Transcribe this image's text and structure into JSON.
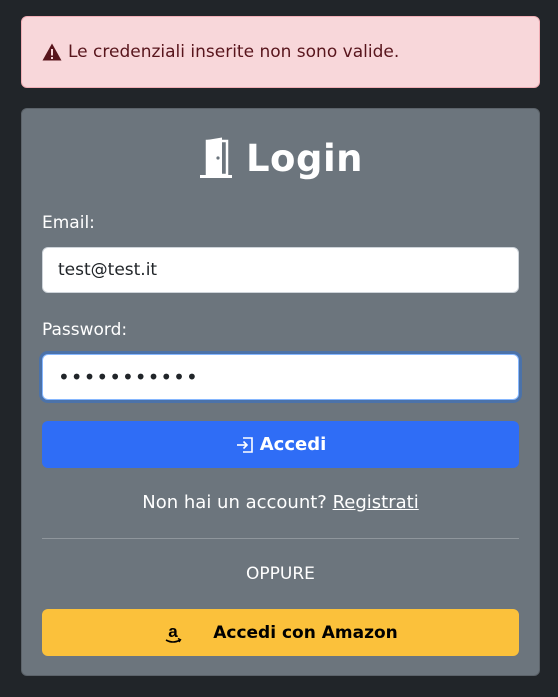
{
  "alert": {
    "icon": "warning-triangle-icon",
    "message": "Le credenziali inserite non sono valide."
  },
  "card": {
    "title_icon": "door-icon",
    "title": "Login",
    "email": {
      "label": "Email:",
      "value": "test@test.it"
    },
    "password": {
      "label": "Password:",
      "masked_value": "•••••••••••"
    },
    "submit": {
      "icon": "box-arrow-in-right-icon",
      "label": "Accedi"
    },
    "register": {
      "prompt": "Non hai un account?",
      "link_label": "Registrati"
    },
    "divider_text": "OPPURE",
    "amazon": {
      "icon": "amazon-icon",
      "label": "Accedi con Amazon"
    }
  },
  "colors": {
    "page_bg": "#212529",
    "alert_bg": "#f8d7da",
    "alert_text": "#58151c",
    "card_bg": "#6c757d",
    "primary": "#2f6df6",
    "amazon": "#fbc13b"
  }
}
